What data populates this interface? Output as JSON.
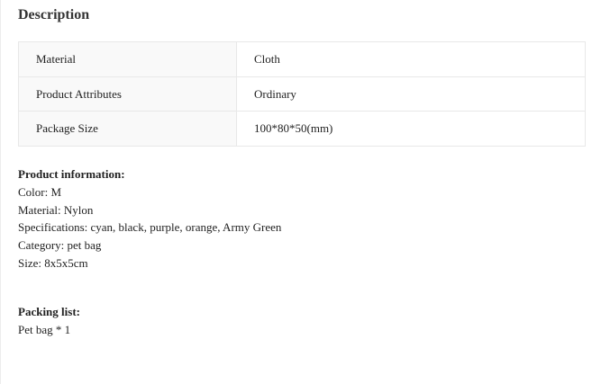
{
  "description": {
    "title": "Description"
  },
  "specs": [
    {
      "key": "Material",
      "value": "Cloth"
    },
    {
      "key": "Product Attributes",
      "value": "Ordinary"
    },
    {
      "key": "Package Size",
      "value": "100*80*50(mm)"
    }
  ],
  "product_info": {
    "heading": "Product information:",
    "lines": [
      "Color: M",
      "Material: Nylon",
      "Specifications: cyan, black, purple, orange, Army Green",
      "Category: pet bag",
      "Size: 8x5x5cm"
    ]
  },
  "packing": {
    "heading": "Packing list:",
    "lines": [
      "Pet bag * 1"
    ]
  }
}
